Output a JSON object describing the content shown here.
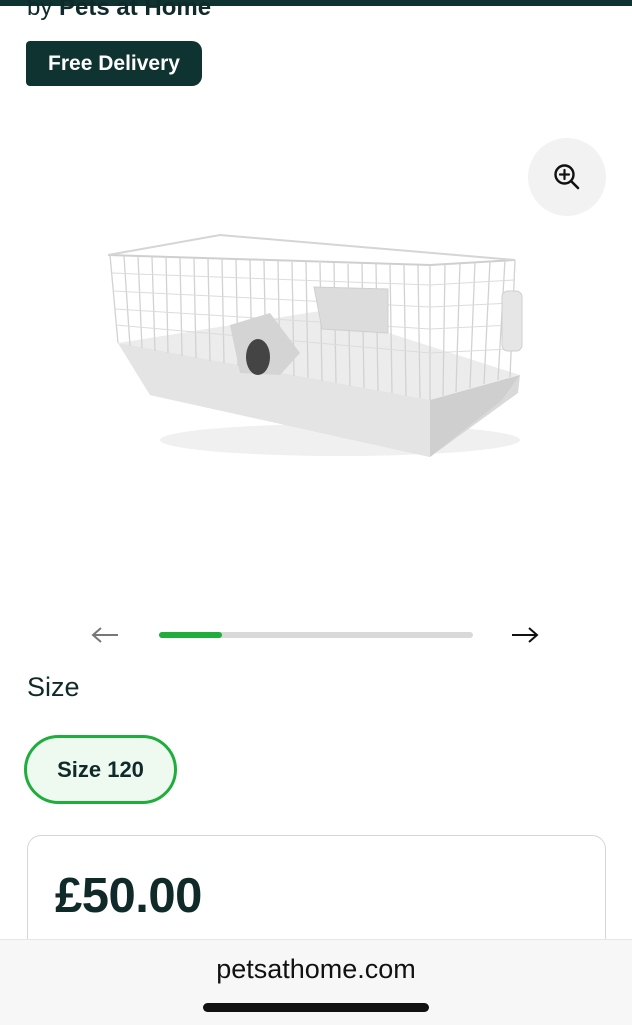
{
  "header": {
    "by_text": "by",
    "brand_name": "Pets at Home",
    "badge": "Free Delivery"
  },
  "gallery": {
    "zoom_icon": "zoom-in-icon",
    "prev_icon": "arrow-left-icon",
    "next_icon": "arrow-right-icon",
    "progress": 0.2
  },
  "size": {
    "label": "Size",
    "selected_option": "Size 120"
  },
  "price": {
    "value": "£50.00"
  },
  "browser": {
    "url": "petsathome.com"
  },
  "colors": {
    "brand_dark": "#0f3331",
    "accent_green": "#1fad3c"
  }
}
